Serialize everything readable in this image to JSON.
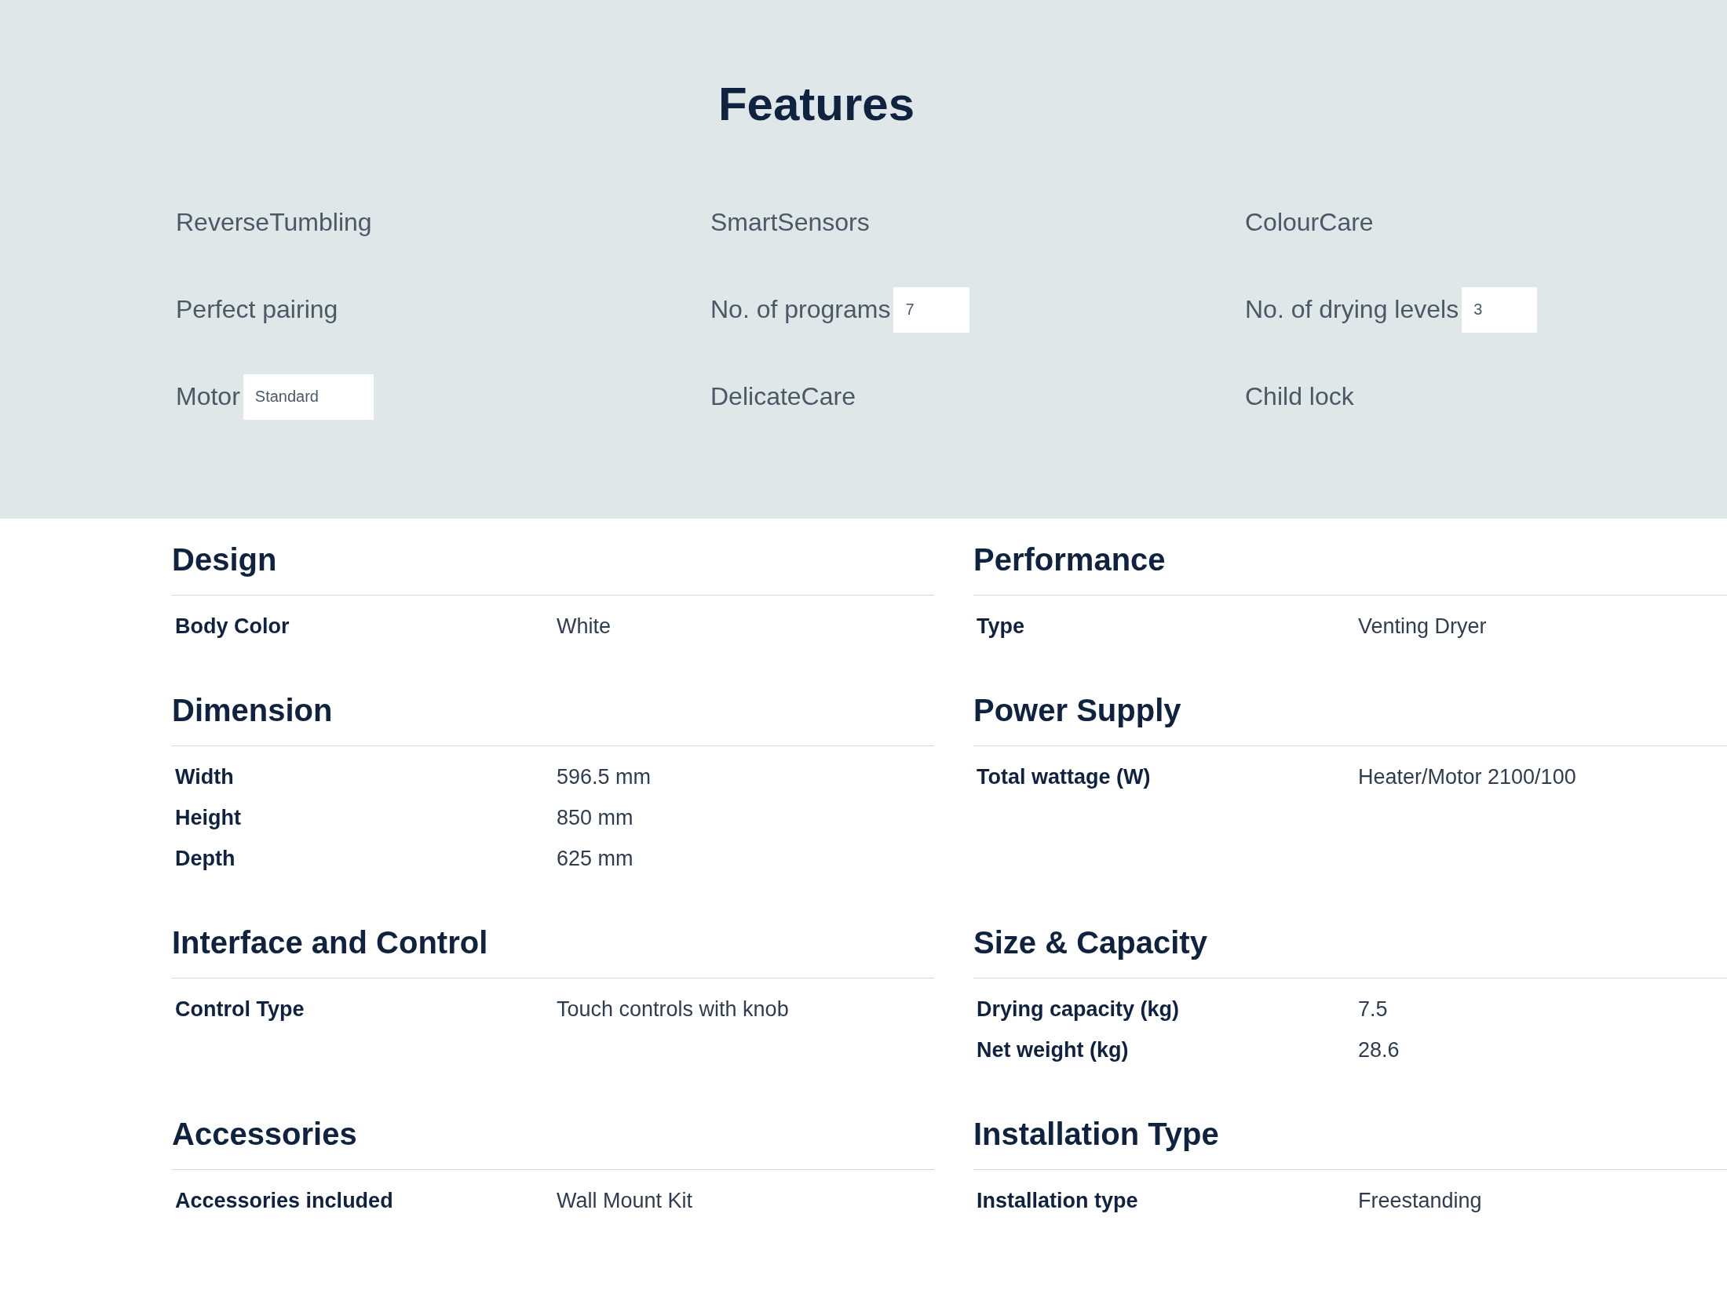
{
  "features": {
    "title": "Features",
    "items": [
      {
        "label": "ReverseTumbling"
      },
      {
        "label": "SmartSensors"
      },
      {
        "label": "ColourCare"
      },
      {
        "label": "Perfect pairing"
      },
      {
        "label": "No. of programs",
        "value": "7"
      },
      {
        "label": "No. of drying levels",
        "value": "3"
      },
      {
        "label": "Motor",
        "value": "Standard"
      },
      {
        "label": "DelicateCare"
      },
      {
        "label": "Child lock"
      }
    ]
  },
  "spec_groups": [
    {
      "title": "Design",
      "rows": [
        {
          "label": "Body Color",
          "value": "White"
        }
      ]
    },
    {
      "title": "Performance",
      "rows": [
        {
          "label": "Type",
          "value": "Venting Dryer"
        }
      ]
    },
    {
      "title": "Dimension",
      "rows": [
        {
          "label": "Width",
          "value": "596.5 mm"
        },
        {
          "label": "Height",
          "value": "850 mm"
        },
        {
          "label": "Depth",
          "value": "625 mm"
        }
      ]
    },
    {
      "title": "Power Supply",
      "rows": [
        {
          "label": "Total wattage (W)",
          "value": "Heater/Motor 2100/100"
        }
      ]
    },
    {
      "title": "Interface and Control",
      "rows": [
        {
          "label": "Control Type",
          "value": "Touch controls with knob"
        }
      ]
    },
    {
      "title": "Size & Capacity",
      "rows": [
        {
          "label": "Drying capacity (kg)",
          "value": "7.5"
        },
        {
          "label": "Net weight (kg)",
          "value": "28.6"
        }
      ]
    },
    {
      "title": "Accessories",
      "rows": [
        {
          "label": "Accessories included",
          "value": "Wall Mount Kit"
        }
      ]
    },
    {
      "title": "Installation Type",
      "rows": [
        {
          "label": "Installation type",
          "value": "Freestanding"
        }
      ]
    }
  ]
}
